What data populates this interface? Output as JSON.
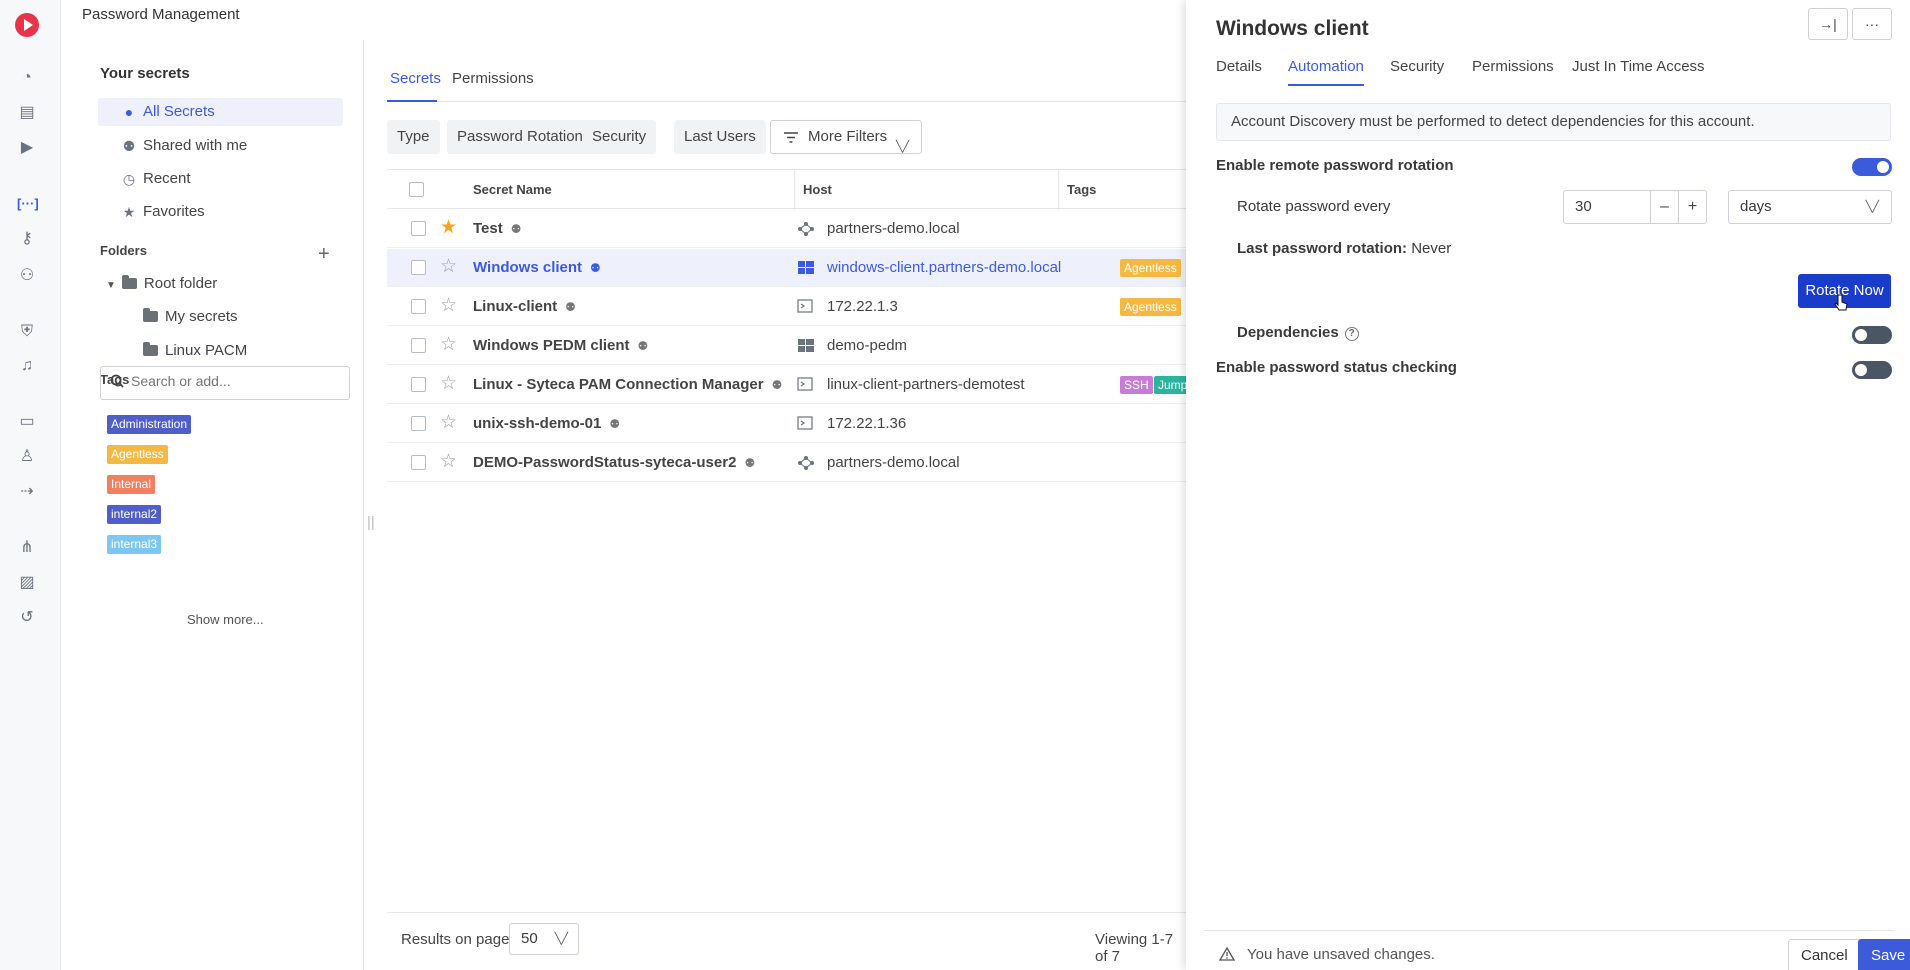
{
  "header": {
    "title": "Password Management"
  },
  "sidebar": {
    "heading": "Your secrets",
    "items": [
      {
        "label": "All Secrets"
      },
      {
        "label": "Shared with me"
      },
      {
        "label": "Recent"
      },
      {
        "label": "Favorites"
      }
    ],
    "folders_label": "Folders",
    "folders": [
      {
        "label": "Root folder"
      },
      {
        "label": "My secrets"
      },
      {
        "label": "Linux PACM"
      }
    ],
    "tags_label": "Tags",
    "tag_search_placeholder": "Search or add...",
    "tags": [
      {
        "label": "Administration",
        "color": "#4f5fc7"
      },
      {
        "label": "Agentless",
        "color": "#f5b942"
      },
      {
        "label": "Internal",
        "color": "#f08060"
      },
      {
        "label": "internal2",
        "color": "#4f5fc7"
      },
      {
        "label": "internal3",
        "color": "#7cc6f0"
      }
    ],
    "show_more": "Show more..."
  },
  "main": {
    "tabs": [
      {
        "label": "Secrets"
      },
      {
        "label": "Permissions"
      }
    ],
    "filters": [
      {
        "label": "Type"
      },
      {
        "label": "Password Rotation"
      },
      {
        "label": "Security"
      },
      {
        "label": "Last Users"
      }
    ],
    "more_filters": "More Filters",
    "columns": {
      "name": "Secret Name",
      "host": "Host",
      "tags": "Tags"
    },
    "rows": [
      {
        "name": "Test",
        "host": "partners-demo.local"
      },
      {
        "name": "Windows client",
        "host": "windows-client.partners-demo.local",
        "tags": [
          "Agentless"
        ]
      },
      {
        "name": "Linux-client",
        "host": "172.22.1.3",
        "tags": [
          "Agentless"
        ]
      },
      {
        "name": "Windows PEDM client",
        "host": "demo-pedm"
      },
      {
        "name": "Linux - Syteca PAM Connection Manager",
        "host": "linux-client-partners-demotest",
        "tags": [
          "SSH",
          "Jump"
        ]
      },
      {
        "name": "unix-ssh-demo-01",
        "host": "172.22.1.36"
      },
      {
        "name": "DEMO-PasswordStatus-syteca-user2",
        "host": "partners-demo.local"
      }
    ],
    "results_label": "Results on page",
    "page_size": "50",
    "viewing": "Viewing 1-7 of 7"
  },
  "drawer": {
    "title": "Windows client",
    "tabs": [
      {
        "label": "Details"
      },
      {
        "label": "Automation"
      },
      {
        "label": "Security"
      },
      {
        "label": "Permissions"
      },
      {
        "label": "Just In Time Access"
      }
    ],
    "info": "Account Discovery must be performed to detect dependencies for this account.",
    "enable_rotation": "Enable remote password rotation",
    "rotate_every": "Rotate password every",
    "rotate_value": "30",
    "rotate_unit": "days",
    "last_rotation_label": "Last password rotation:",
    "last_rotation_value": "Never",
    "rotate_now": "Rotate Now",
    "dependencies": "Dependencies",
    "status_check": "Enable password status checking",
    "unsaved": "You have unsaved changes.",
    "cancel": "Cancel",
    "save": "Save"
  }
}
